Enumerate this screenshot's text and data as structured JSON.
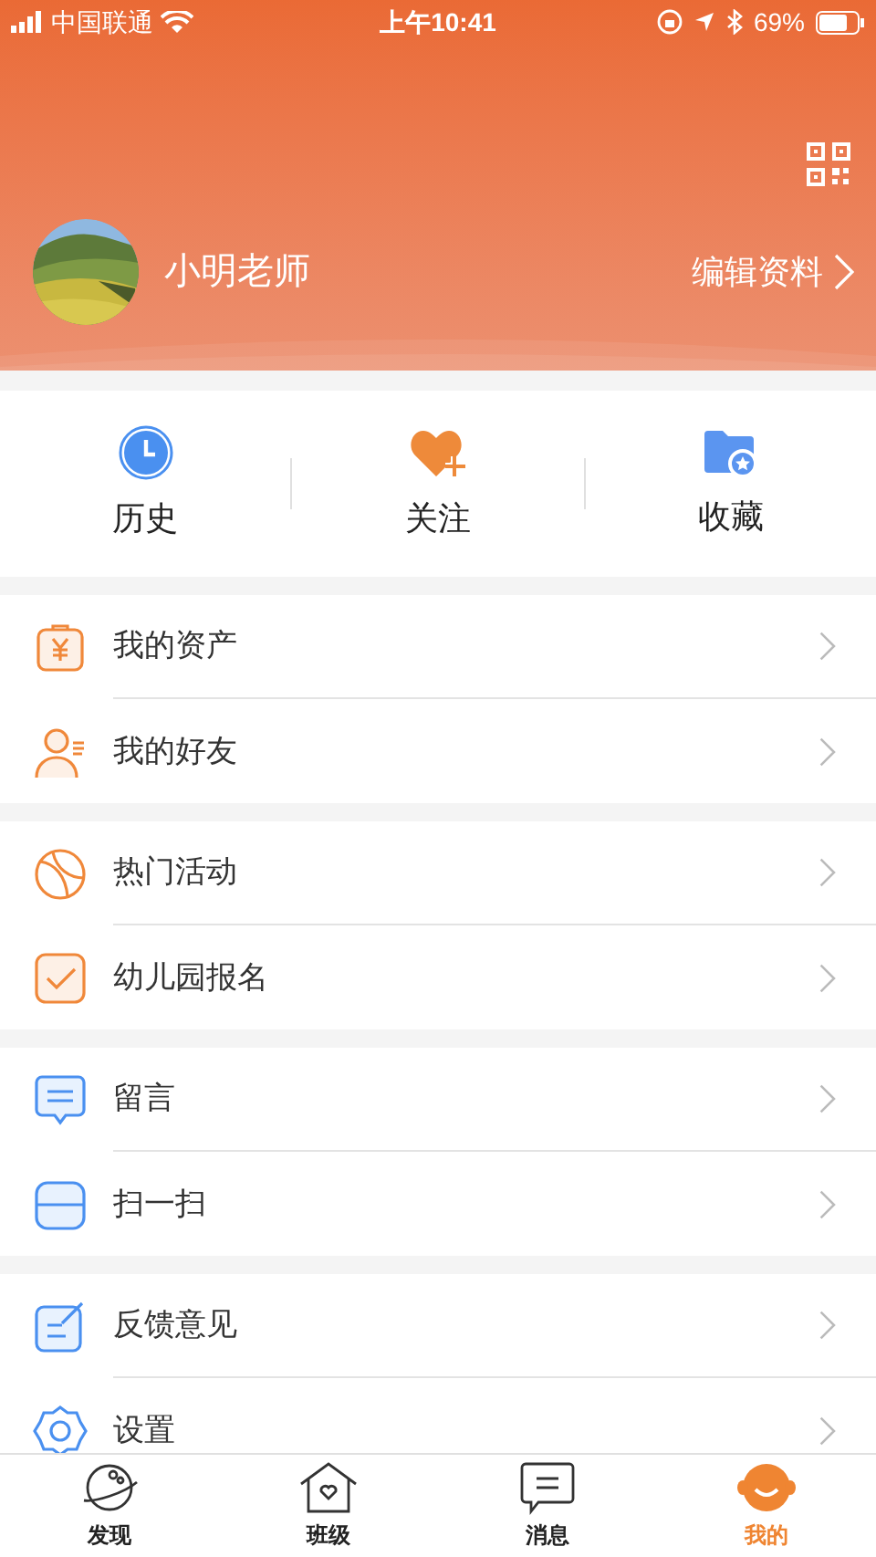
{
  "status_bar": {
    "carrier": "中国联通",
    "time": "上午10:41",
    "battery": "69%"
  },
  "profile": {
    "name": "小明老师",
    "edit_link": "编辑资料"
  },
  "shortcuts": [
    {
      "label": "历史"
    },
    {
      "label": "关注"
    },
    {
      "label": "收藏"
    }
  ],
  "menu_groups": [
    [
      {
        "label": "我的资产"
      },
      {
        "label": "我的好友"
      }
    ],
    [
      {
        "label": "热门活动"
      },
      {
        "label": "幼儿园报名"
      }
    ],
    [
      {
        "label": "留言"
      },
      {
        "label": "扫一扫"
      }
    ],
    [
      {
        "label": "反馈意见"
      },
      {
        "label": "设置"
      }
    ]
  ],
  "tab_bar": [
    {
      "label": "发现",
      "selected": false
    },
    {
      "label": "班级",
      "selected": false
    },
    {
      "label": "消息",
      "selected": false
    },
    {
      "label": "我的",
      "selected": true
    }
  ]
}
